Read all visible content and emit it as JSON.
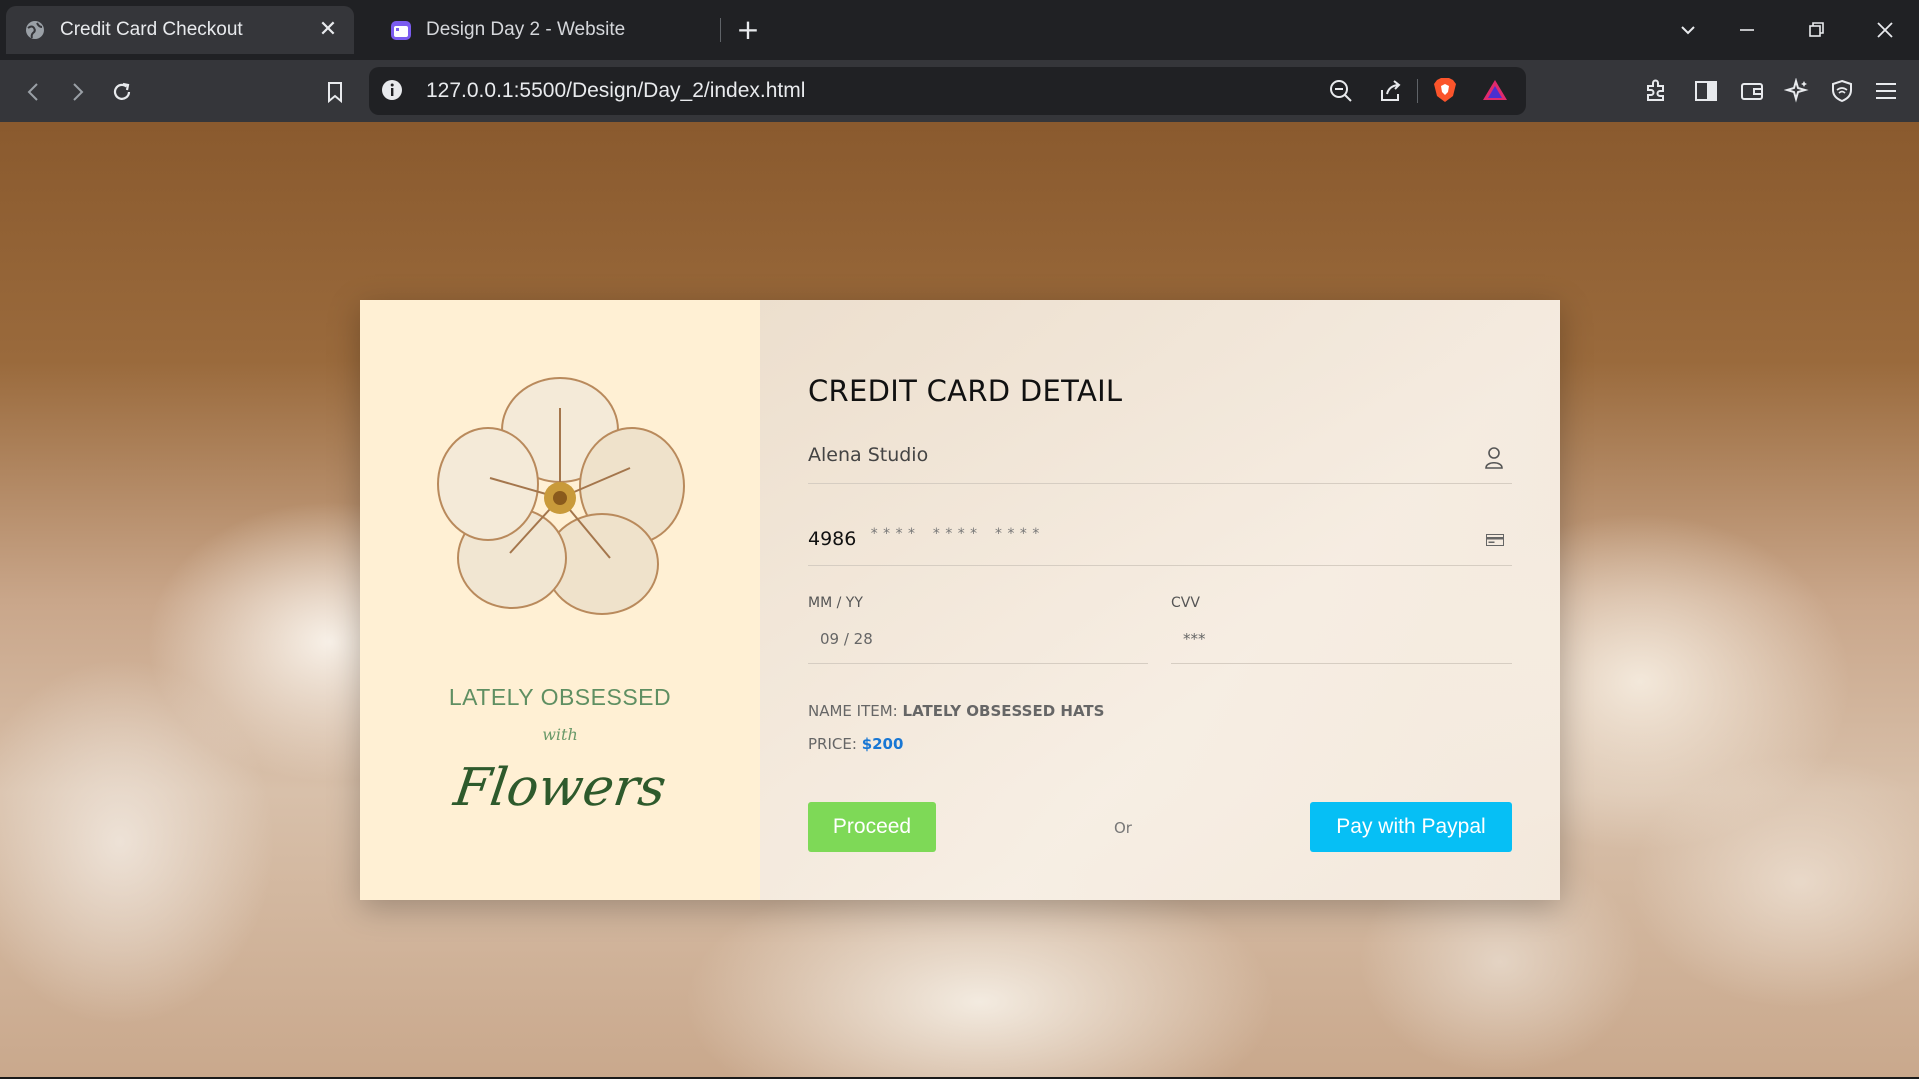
{
  "browser": {
    "tabs": [
      {
        "title": "Credit Card Checkout",
        "active": true
      },
      {
        "title": "Design Day 2 - Website",
        "active": false
      }
    ],
    "url": "127.0.0.1:5500/Design/Day_2/index.html"
  },
  "promo": {
    "line1": "LATELY OBSESSED",
    "line2": "with",
    "line3": "Flowers"
  },
  "form": {
    "title": "CREDIT CARD DETAIL",
    "name_value": "Alena Studio",
    "card_prefix": "4986",
    "card_mask": "**** **** ****",
    "expiry_label": "MM / YY",
    "expiry_value": "09 / 28",
    "cvv_label": "CVV",
    "cvv_value": "***",
    "item_label": "NAME ITEM:",
    "item_value": "LATELY OBSESSED HATS",
    "price_label": "PRICE:",
    "price_value": "$200",
    "proceed_label": "Proceed",
    "or_label": "Or",
    "paypal_label": "Pay with Paypal"
  },
  "colors": {
    "proceed": "#7ed957",
    "paypal": "#06bff5",
    "price": "#1877d4",
    "left_panel": "#fff0d4"
  }
}
